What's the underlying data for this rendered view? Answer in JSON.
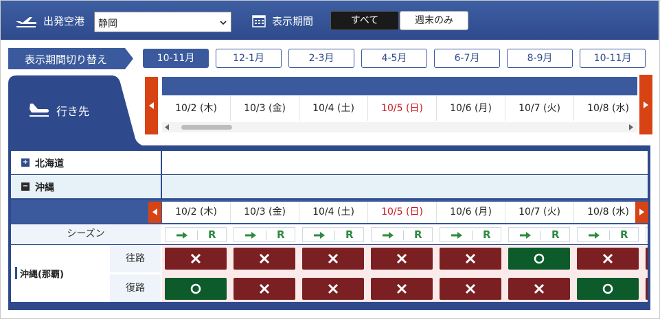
{
  "header": {
    "departure_label": "出発空港",
    "airport_value": "静岡",
    "period_label": "表示期間",
    "filter_all": "すべて",
    "filter_weekend": "週末のみ"
  },
  "period_switch": {
    "label": "表示期間切り替え",
    "tabs": [
      "10-11月",
      "12-1月",
      "2-3月",
      "4-5月",
      "6-7月",
      "8-9月",
      "10-11月"
    ],
    "active_index": 0
  },
  "destination_label": "行き先",
  "dates": [
    {
      "label": "10/2 (木)",
      "sunday": false
    },
    {
      "label": "10/3 (金)",
      "sunday": false
    },
    {
      "label": "10/4 (土)",
      "sunday": false
    },
    {
      "label": "10/5 (日)",
      "sunday": true
    },
    {
      "label": "10/6 (月)",
      "sunday": false
    },
    {
      "label": "10/7 (火)",
      "sunday": false
    },
    {
      "label": "10/8 (水)",
      "sunday": false
    }
  ],
  "regions": [
    {
      "name": "北海道",
      "toggle": "+"
    },
    {
      "name": "沖縄",
      "toggle": "−"
    }
  ],
  "season": {
    "label": "シーズン",
    "letter": "R"
  },
  "route": {
    "name": "沖縄(那覇)",
    "outbound_label": "往路",
    "return_label": "復路",
    "outbound": [
      "no",
      "no",
      "no",
      "no",
      "no",
      "ok",
      "no"
    ],
    "return": [
      "ok",
      "no",
      "no",
      "no",
      "no",
      "no",
      "ok"
    ]
  },
  "colors": {
    "primary": "#2e4a8c",
    "accent": "#d84314",
    "sunday": "#c8171e",
    "unavailable": "#7a2022",
    "available": "#0d5a2a"
  }
}
